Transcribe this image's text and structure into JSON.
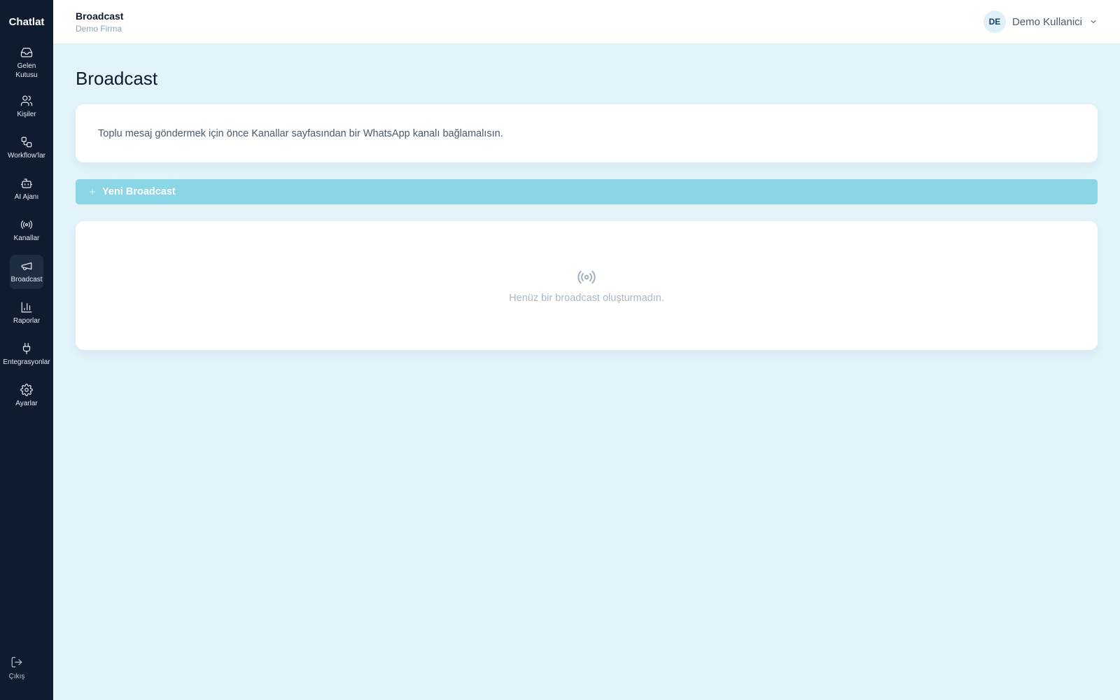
{
  "app": {
    "brand": "Chatlat"
  },
  "sidebar": {
    "items": [
      {
        "label": "Gelen Kutusu",
        "icon": "inbox-icon"
      },
      {
        "label": "Kişiler",
        "icon": "users-icon"
      },
      {
        "label": "Workflow'lar",
        "icon": "workflow-icon"
      },
      {
        "label": "AI Ajanı",
        "icon": "bot-icon"
      },
      {
        "label": "Kanallar",
        "icon": "radio-icon"
      },
      {
        "label": "Broadcast",
        "icon": "megaphone-icon",
        "active": true
      },
      {
        "label": "Raporlar",
        "icon": "bar-chart-icon"
      },
      {
        "label": "Entegrasyonlar",
        "icon": "plug-icon"
      },
      {
        "label": "Ayarlar",
        "icon": "gear-icon"
      }
    ],
    "logout": {
      "label": "Çıkış",
      "icon": "logout-icon"
    }
  },
  "topbar": {
    "title": "Broadcast",
    "subtitle": "Demo Firma",
    "user": {
      "initials": "DE",
      "name": "Demo Kullanici"
    }
  },
  "main": {
    "title": "Broadcast",
    "notice": "Toplu mesaj göndermek için önce Kanallar sayfasından bir WhatsApp kanalı bağlamalısın.",
    "new_button": "Yeni Broadcast",
    "empty_state": "Henüz bir broadcast oluşturmadın."
  },
  "colors": {
    "sidebar_bg": "#0f1b2e",
    "page_bg": "#e2f4fa",
    "button_bg": "#8ad5e6",
    "active_item_bg": "#1f2d42"
  }
}
